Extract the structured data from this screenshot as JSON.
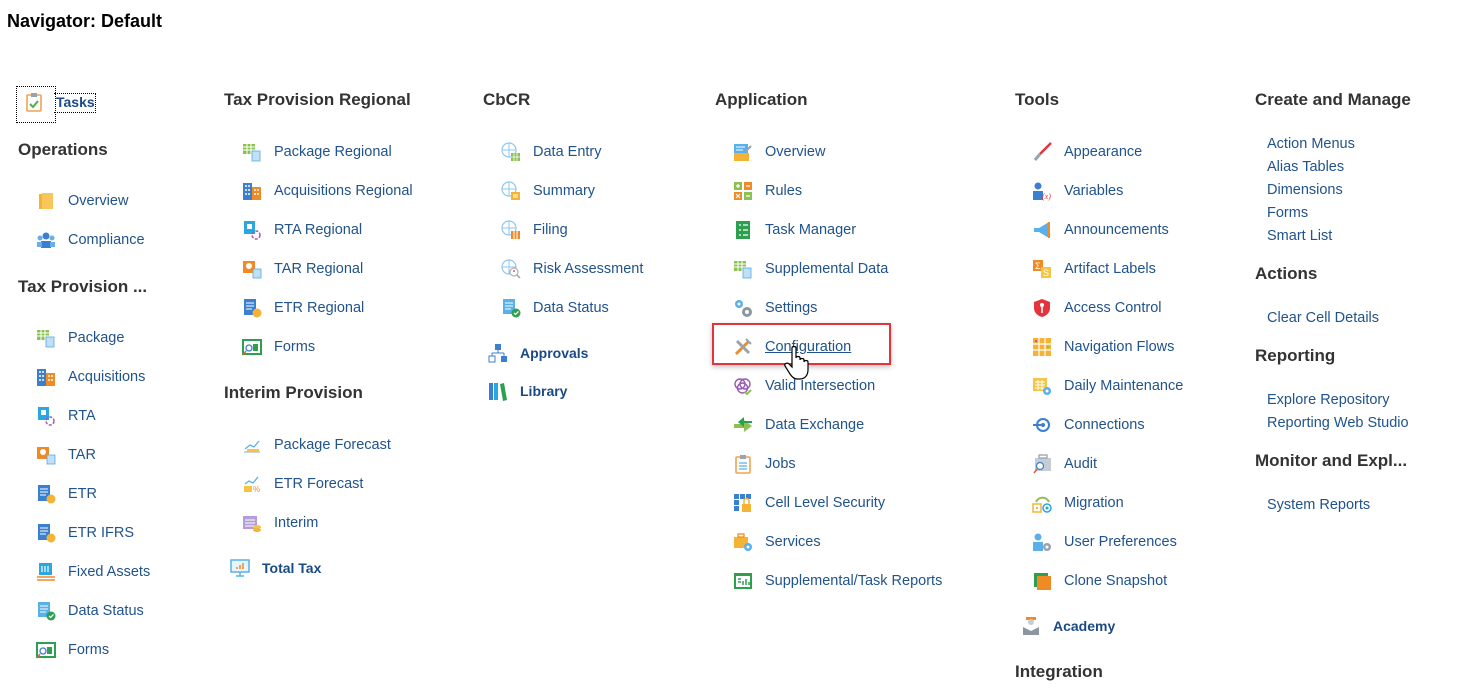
{
  "page": {
    "title": "Navigator: Default"
  },
  "columns": [
    {
      "id": "col1",
      "blocks": [
        {
          "type": "link-bold",
          "label": "Tasks",
          "icon": "clipboard-check-icon"
        },
        {
          "type": "header",
          "label": "Operations"
        },
        {
          "type": "item",
          "label": "Overview",
          "icon": "folder-stack-icon"
        },
        {
          "type": "item",
          "label": "Compliance",
          "icon": "people-group-icon"
        },
        {
          "type": "header",
          "label": "Tax Provision ..."
        },
        {
          "type": "item",
          "label": "Package",
          "icon": "grid-calculator-icon"
        },
        {
          "type": "item",
          "label": "Acquisitions",
          "icon": "buildings-icon"
        },
        {
          "type": "item",
          "label": "RTA",
          "icon": "document-cycle-icon"
        },
        {
          "type": "item",
          "label": "TAR",
          "icon": "chart-table-icon"
        },
        {
          "type": "item",
          "label": "ETR",
          "icon": "document-percent-icon"
        },
        {
          "type": "item",
          "label": "ETR IFRS",
          "icon": "document-percent-icon"
        },
        {
          "type": "item",
          "label": "Fixed Assets",
          "icon": "building-list-icon"
        },
        {
          "type": "item",
          "label": "Data Status",
          "icon": "document-check-icon"
        },
        {
          "type": "item",
          "label": "Forms",
          "icon": "form-search-icon"
        }
      ]
    },
    {
      "id": "col2",
      "blocks": [
        {
          "type": "header",
          "label": "Tax Provision Regional"
        },
        {
          "type": "item",
          "label": "Package Regional",
          "icon": "grid-calculator-icon"
        },
        {
          "type": "item",
          "label": "Acquisitions Regional",
          "icon": "buildings-icon"
        },
        {
          "type": "item",
          "label": "RTA Regional",
          "icon": "document-cycle-icon"
        },
        {
          "type": "item",
          "label": "TAR Regional",
          "icon": "chart-table-icon"
        },
        {
          "type": "item",
          "label": "ETR Regional",
          "icon": "document-percent-icon"
        },
        {
          "type": "item",
          "label": "Forms",
          "icon": "form-search-icon"
        },
        {
          "type": "header",
          "label": "Interim Provision"
        },
        {
          "type": "item",
          "label": "Package Forecast",
          "icon": "line-chart-icon"
        },
        {
          "type": "item",
          "label": "ETR Forecast",
          "icon": "forecast-percent-icon"
        },
        {
          "type": "item",
          "label": "Interim",
          "icon": "calendar-coins-icon"
        },
        {
          "type": "link-bold",
          "label": "Total Tax",
          "icon": "monitor-chart-icon"
        }
      ]
    },
    {
      "id": "col3",
      "blocks": [
        {
          "type": "header",
          "label": "CbCR"
        },
        {
          "type": "item",
          "label": "Data Entry",
          "icon": "globe-grid-icon"
        },
        {
          "type": "item",
          "label": "Summary",
          "icon": "globe-card-icon"
        },
        {
          "type": "item",
          "label": "Filing",
          "icon": "globe-files-icon"
        },
        {
          "type": "item",
          "label": "Risk Assessment",
          "icon": "globe-search-icon"
        },
        {
          "type": "item",
          "label": "Data Status",
          "icon": "document-check-icon"
        },
        {
          "type": "link-bold",
          "label": "Approvals",
          "icon": "hierarchy-icon"
        },
        {
          "type": "link-bold",
          "label": "Library",
          "icon": "books-icon"
        }
      ]
    },
    {
      "id": "col4",
      "blocks": [
        {
          "type": "header",
          "label": "Application"
        },
        {
          "type": "item",
          "label": "Overview",
          "icon": "edit-box-icon"
        },
        {
          "type": "item",
          "label": "Rules",
          "icon": "calculator-ops-icon"
        },
        {
          "type": "item",
          "label": "Task Manager",
          "icon": "checklist-icon"
        },
        {
          "type": "item",
          "label": "Supplemental Data",
          "icon": "grid-calculator-icon"
        },
        {
          "type": "item",
          "label": "Settings",
          "icon": "gears-icon"
        },
        {
          "type": "item",
          "label": "Configuration",
          "icon": "tools-icon",
          "highlighted": true
        },
        {
          "type": "item",
          "label": "Valid Intersection",
          "icon": "venn-check-icon"
        },
        {
          "type": "item",
          "label": "Data Exchange",
          "icon": "exchange-arrows-icon"
        },
        {
          "type": "item",
          "label": "Jobs",
          "icon": "clipboard-list-icon"
        },
        {
          "type": "item",
          "label": "Cell Level Security",
          "icon": "grid-lock-icon"
        },
        {
          "type": "item",
          "label": "Services",
          "icon": "briefcase-gear-icon"
        },
        {
          "type": "item",
          "label": "Supplemental/Task Reports",
          "icon": "report-chart-icon"
        }
      ]
    },
    {
      "id": "col5",
      "blocks": [
        {
          "type": "header",
          "label": "Tools"
        },
        {
          "type": "item",
          "label": "Appearance",
          "icon": "paintbrush-icon"
        },
        {
          "type": "item",
          "label": "Variables",
          "icon": "user-variable-icon"
        },
        {
          "type": "item",
          "label": "Announcements",
          "icon": "megaphone-icon"
        },
        {
          "type": "item",
          "label": "Artifact Labels",
          "icon": "sigma-label-icon"
        },
        {
          "type": "item",
          "label": "Access Control",
          "icon": "shield-key-icon"
        },
        {
          "type": "item",
          "label": "Navigation Flows",
          "icon": "grid-flow-icon"
        },
        {
          "type": "item",
          "label": "Daily Maintenance",
          "icon": "calendar-gear-icon"
        },
        {
          "type": "item",
          "label": "Connections",
          "icon": "connection-icon"
        },
        {
          "type": "item",
          "label": "Audit",
          "icon": "briefcase-search-icon"
        },
        {
          "type": "item",
          "label": "Migration",
          "icon": "migration-icon"
        },
        {
          "type": "item",
          "label": "User Preferences",
          "icon": "user-gear-icon"
        },
        {
          "type": "item",
          "label": "Clone Snapshot",
          "icon": "clone-icon"
        },
        {
          "type": "link-bold",
          "label": "Academy",
          "icon": "graduate-icon"
        },
        {
          "type": "header",
          "label": "Integration"
        }
      ]
    },
    {
      "id": "col6",
      "blocks": [
        {
          "type": "header",
          "label": "Create and Manage"
        },
        {
          "type": "plain",
          "label": "Action Menus"
        },
        {
          "type": "plain",
          "label": "Alias Tables"
        },
        {
          "type": "plain",
          "label": "Dimensions"
        },
        {
          "type": "plain",
          "label": "Forms"
        },
        {
          "type": "plain",
          "label": "Smart List"
        },
        {
          "type": "header",
          "label": "Actions"
        },
        {
          "type": "plain",
          "label": "Clear Cell Details"
        },
        {
          "type": "header",
          "label": "Reporting"
        },
        {
          "type": "plain",
          "label": "Explore Repository"
        },
        {
          "type": "plain",
          "label": "Reporting Web Studio"
        },
        {
          "type": "header",
          "label": "Monitor and Expl..."
        },
        {
          "type": "plain",
          "label": "System Reports"
        }
      ]
    }
  ],
  "colors": {
    "link": "#21538c",
    "header": "#333333",
    "highlight": "#e3343b"
  }
}
